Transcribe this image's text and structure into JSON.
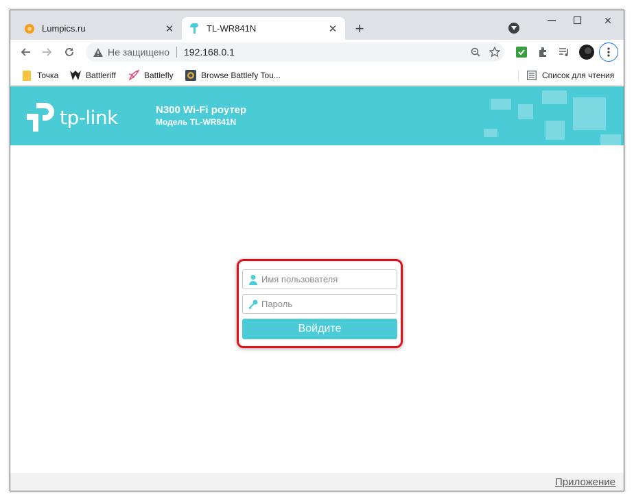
{
  "browser": {
    "tabs": [
      {
        "title": "Lumpics.ru",
        "favicon_color": "#f29e1f",
        "active": false
      },
      {
        "title": "TL-WR841N",
        "favicon_color": "#4acbd6",
        "active": true
      }
    ],
    "address_bar": {
      "security_label": "Не защищено",
      "url": "192.168.0.1"
    },
    "bookmarks": [
      {
        "label": "Точка",
        "icon": "folder-icon"
      },
      {
        "label": "Battleriff",
        "icon": "battleriff-icon"
      },
      {
        "label": "Battlefly",
        "icon": "battlefly-icon"
      },
      {
        "label": "Browse Battlefy Tou..."
      }
    ],
    "reading_list": "Список для чтения"
  },
  "router_page": {
    "brand": "tp-link",
    "product_title": "N300 Wi-Fi роутер",
    "model_line": "Модель TL-WR841N",
    "login": {
      "username_placeholder": "Имя пользователя",
      "password_placeholder": "Пароль",
      "submit_label": "Войдите"
    },
    "footer_link": "Приложение",
    "accent_color": "#4acbd6",
    "highlight_color": "#e0101b"
  }
}
